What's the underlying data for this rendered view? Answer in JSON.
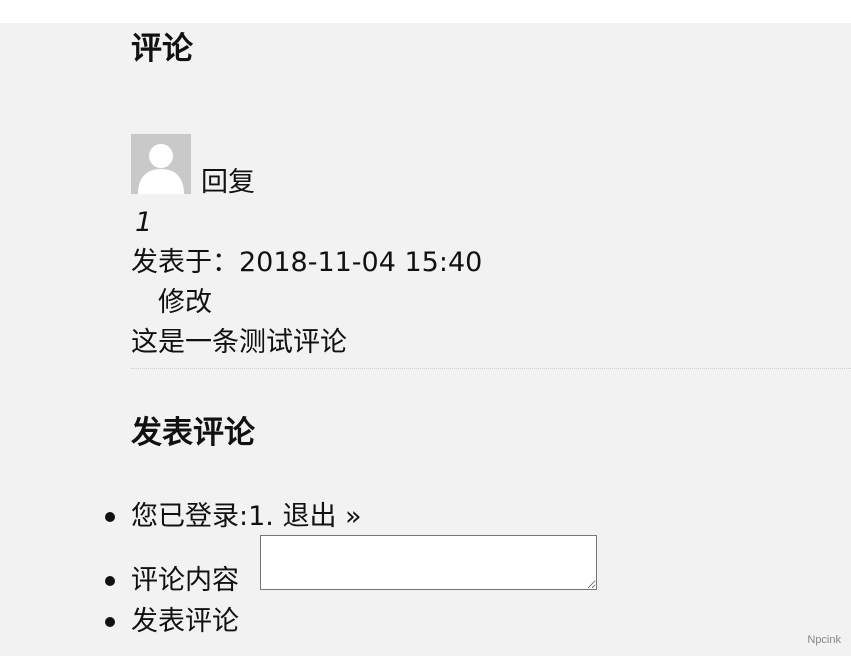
{
  "comments": {
    "title": "评论",
    "items": [
      {
        "reply_label": "回复",
        "author": "1",
        "date_text": "发表于：2018-11-04 15:40",
        "edit_label": "修改",
        "text": "这是一条测试评论"
      }
    ]
  },
  "respond": {
    "title": "发表评论",
    "logged_in_prefix": "您已登录:1.",
    "logout_label": "退出 »",
    "comment_label": "评论内容",
    "comment_value": "",
    "submit_label": "发表评论"
  },
  "footer": {
    "watermark": "Npcink"
  },
  "icons": {
    "avatar": "default-user-avatar-icon"
  },
  "colors": {
    "page_background": "#f2f2f2",
    "avatar_background": "#c9c9c9",
    "text": "#111111"
  }
}
